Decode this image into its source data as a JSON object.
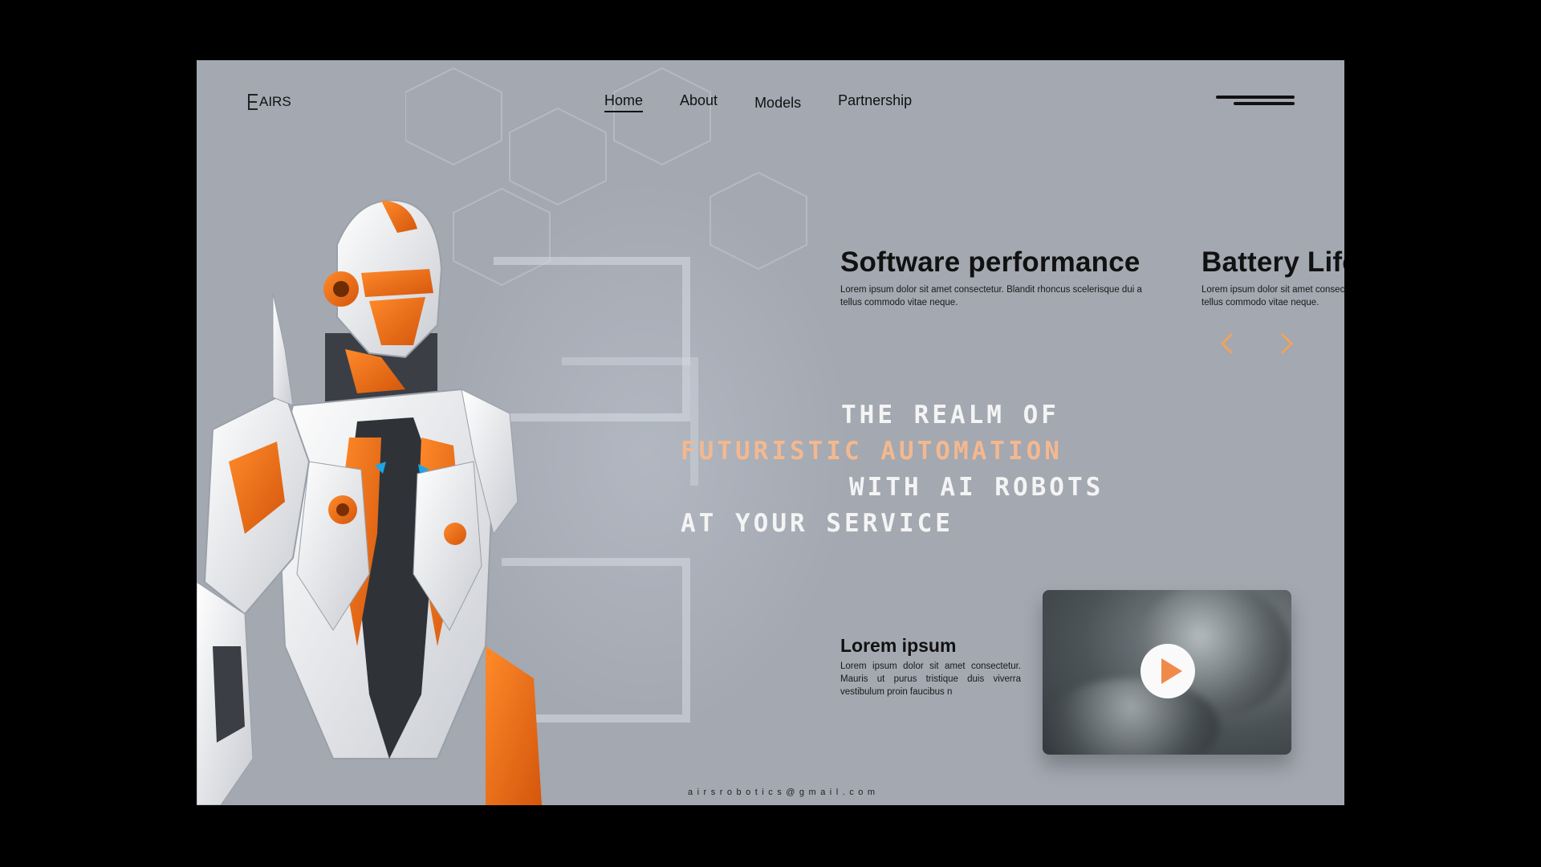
{
  "brand": {
    "name": "AIRS"
  },
  "nav": {
    "items": [
      {
        "label": "Home",
        "active": true
      },
      {
        "label": "About",
        "active": false
      },
      {
        "label": "Models",
        "active": false
      },
      {
        "label": "Partnership",
        "active": false
      }
    ]
  },
  "features": [
    {
      "title": "Software performance",
      "text": "Lorem ipsum dolor sit amet consectetur. Blandit rhoncus scelerisque dui a tellus commodo vitae neque."
    },
    {
      "title": "Battery Life",
      "text": "Lorem ipsum dolor sit amet consectetur. Blandit rhoncus scelerisque dui a tellus commodo vitae neque."
    }
  ],
  "headline": {
    "line1": "THE REALM OF",
    "line2": "FUTURISTIC AUTOMATION",
    "line3": "WITH AI ROBOTS",
    "line4": "AT YOUR SERVICE"
  },
  "info": {
    "title": "Lorem ipsum",
    "text": "Lorem ipsum dolor sit amet consectetur. Mauris ut purus tristique duis viverra vestibulum proin faucibus n"
  },
  "footer": {
    "email": "airsrobotics@gmail.com"
  },
  "colors": {
    "background": "#a3a8b1",
    "accent": "#f08a4b",
    "headline_accent": "#f4b88f",
    "arrow": "#f2a35a"
  },
  "icons": {
    "prev": "chevron-left-icon",
    "next": "chevron-right-icon",
    "play": "play-icon",
    "menu": "hamburger-menu-icon"
  }
}
